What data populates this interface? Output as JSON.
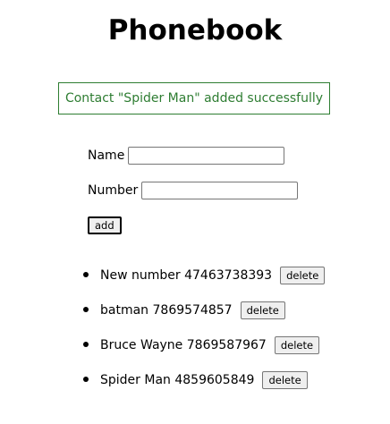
{
  "app": {
    "title": "Phonebook"
  },
  "notification": {
    "message": "Contact \"Spider Man\" added successfully",
    "color": "#2e7d32"
  },
  "form": {
    "name_label": "Name",
    "name_value": "",
    "number_label": "Number",
    "number_value": "",
    "add_label": "add"
  },
  "contacts": [
    {
      "name": "New number",
      "number": "47463738393",
      "delete_label": "delete"
    },
    {
      "name": "batman",
      "number": "7869574857",
      "delete_label": "delete"
    },
    {
      "name": "Bruce Wayne",
      "number": "7869587967",
      "delete_label": "delete"
    },
    {
      "name": "Spider Man",
      "number": "4859605849",
      "delete_label": "delete"
    }
  ]
}
